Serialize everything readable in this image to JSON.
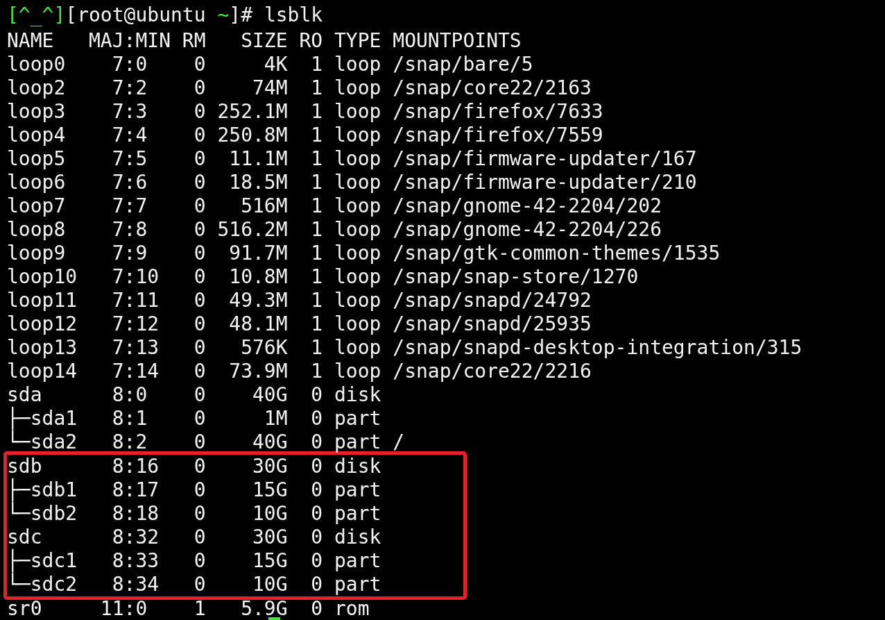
{
  "terminal": {
    "prompt": [
      {
        "text": "[^_^]",
        "color": "#3ee83e"
      },
      {
        "text": "[root@ubuntu ",
        "color": "#f2f2f2"
      },
      {
        "text": "~",
        "color": "#3ee83e"
      },
      {
        "text": "]# lsblk",
        "color": "#f2f2f2"
      }
    ],
    "lines": [
      {
        "text": "NAME   MAJ:MIN RM   SIZE RO TYPE MOUNTPOINTS",
        "highlighted": false
      },
      {
        "text": "loop0    7:0    0     4K  1 loop /snap/bare/5",
        "highlighted": false
      },
      {
        "text": "loop2    7:2    0    74M  1 loop /snap/core22/2163",
        "highlighted": false
      },
      {
        "text": "loop3    7:3    0 252.1M  1 loop /snap/firefox/7633",
        "highlighted": false
      },
      {
        "text": "loop4    7:4    0 250.8M  1 loop /snap/firefox/7559",
        "highlighted": false
      },
      {
        "text": "loop5    7:5    0  11.1M  1 loop /snap/firmware-updater/167",
        "highlighted": false
      },
      {
        "text": "loop6    7:6    0  18.5M  1 loop /snap/firmware-updater/210",
        "highlighted": false
      },
      {
        "text": "loop7    7:7    0   516M  1 loop /snap/gnome-42-2204/202",
        "highlighted": false
      },
      {
        "text": "loop8    7:8    0 516.2M  1 loop /snap/gnome-42-2204/226",
        "highlighted": false
      },
      {
        "text": "loop9    7:9    0  91.7M  1 loop /snap/gtk-common-themes/1535",
        "highlighted": false
      },
      {
        "text": "loop10   7:10   0  10.8M  1 loop /snap/snap-store/1270",
        "highlighted": false
      },
      {
        "text": "loop11   7:11   0  49.3M  1 loop /snap/snapd/24792",
        "highlighted": false
      },
      {
        "text": "loop12   7:12   0  48.1M  1 loop /snap/snapd/25935",
        "highlighted": false
      },
      {
        "text": "loop13   7:13   0   576K  1 loop /snap/snapd-desktop-integration/315",
        "highlighted": false
      },
      {
        "text": "loop14   7:14   0  73.9M  1 loop /snap/core22/2216",
        "highlighted": false
      },
      {
        "text": "sda      8:0    0    40G  0 disk",
        "highlighted": false
      },
      {
        "text": "├─sda1   8:1    0     1M  0 part",
        "highlighted": false
      },
      {
        "text": "└─sda2   8:2    0    40G  0 part /",
        "highlighted": false
      },
      {
        "text": "sdb      8:16   0    30G  0 disk",
        "highlighted": true
      },
      {
        "text": "├─sdb1   8:17   0    15G  0 part",
        "highlighted": true
      },
      {
        "text": "└─sdb2   8:18   0    10G  0 part",
        "highlighted": true
      },
      {
        "text": "sdc      8:32   0    30G  0 disk",
        "highlighted": true
      },
      {
        "text": "├─sdc1   8:33   0    15G  0 part",
        "highlighted": true
      },
      {
        "text": "└─sdc2   8:34   0    10G  0 part",
        "highlighted": true
      },
      {
        "text": "sr0     11:0    1   5.9G  0 rom",
        "highlighted": false
      }
    ],
    "cursor": true
  }
}
